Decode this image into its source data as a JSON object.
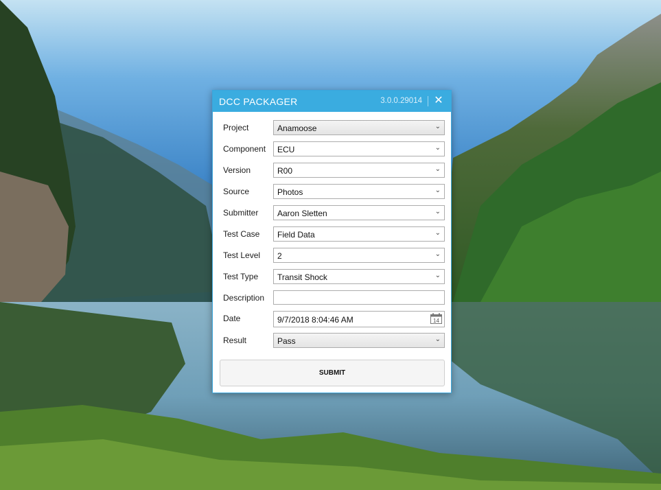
{
  "dialog": {
    "title": "DCC PACKAGER",
    "version": "3.0.0.29014",
    "close_icon": "close-icon"
  },
  "form": {
    "fields": [
      {
        "label": "Project",
        "value": "Anamoose",
        "type": "dropdown"
      },
      {
        "label": "Component",
        "value": "ECU",
        "type": "dropdown"
      },
      {
        "label": "Version",
        "value": "R00",
        "type": "dropdown"
      },
      {
        "label": "Source",
        "value": "Photos",
        "type": "dropdown"
      },
      {
        "label": "Submitter",
        "value": "Aaron Sletten",
        "type": "dropdown"
      },
      {
        "label": "Test Case",
        "value": "Field Data",
        "type": "dropdown"
      },
      {
        "label": "Test Level",
        "value": "2",
        "type": "dropdown"
      },
      {
        "label": "Test Type",
        "value": "Transit Shock",
        "type": "dropdown"
      },
      {
        "label": "Description",
        "value": "",
        "type": "text"
      },
      {
        "label": "Date",
        "value": "9/7/2018 8:04:46 AM",
        "type": "datepicker",
        "calendar_day": "14"
      },
      {
        "label": "Result",
        "value": "Pass",
        "type": "dropdown"
      }
    ],
    "submit_label": "SUBMIT"
  },
  "colors": {
    "titlebar": "#3aace0",
    "border": "#3aa6dc"
  }
}
